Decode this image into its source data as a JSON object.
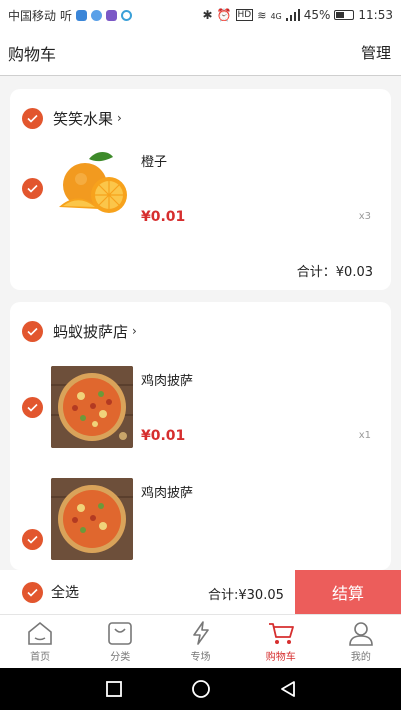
{
  "status_bar": {
    "carrier": "中国移动",
    "carrier_extra": "听",
    "network": "4G",
    "battery": "45%",
    "battery_level": 0.45,
    "time": "11:53"
  },
  "header": {
    "title": "购物车",
    "manage": "管理"
  },
  "stores": [
    {
      "name": "笑笑水果",
      "items": [
        {
          "name": "橙子",
          "price": "¥0.01",
          "qty": "x3"
        }
      ],
      "subtotal": "合计：¥0.03"
    },
    {
      "name": "蚂蚁披萨店",
      "items": [
        {
          "name": "鸡肉披萨",
          "price": "¥0.01",
          "qty": "x1"
        },
        {
          "name": "鸡肉披萨",
          "price": "",
          "qty": ""
        }
      ]
    }
  ],
  "checkout": {
    "select_all": "全选",
    "total": "合计:¥30.05",
    "button": "结算"
  },
  "tabs": [
    {
      "label": "首页",
      "icon": "home-icon"
    },
    {
      "label": "分类",
      "icon": "bag-icon"
    },
    {
      "label": "专场",
      "icon": "lightning-icon"
    },
    {
      "label": "购物车",
      "icon": "cart-icon"
    },
    {
      "label": "我的",
      "icon": "user-icon"
    }
  ],
  "colors": {
    "accent": "#e2562e",
    "price": "#d62e2e",
    "checkout_button": "#ec5d5b"
  }
}
